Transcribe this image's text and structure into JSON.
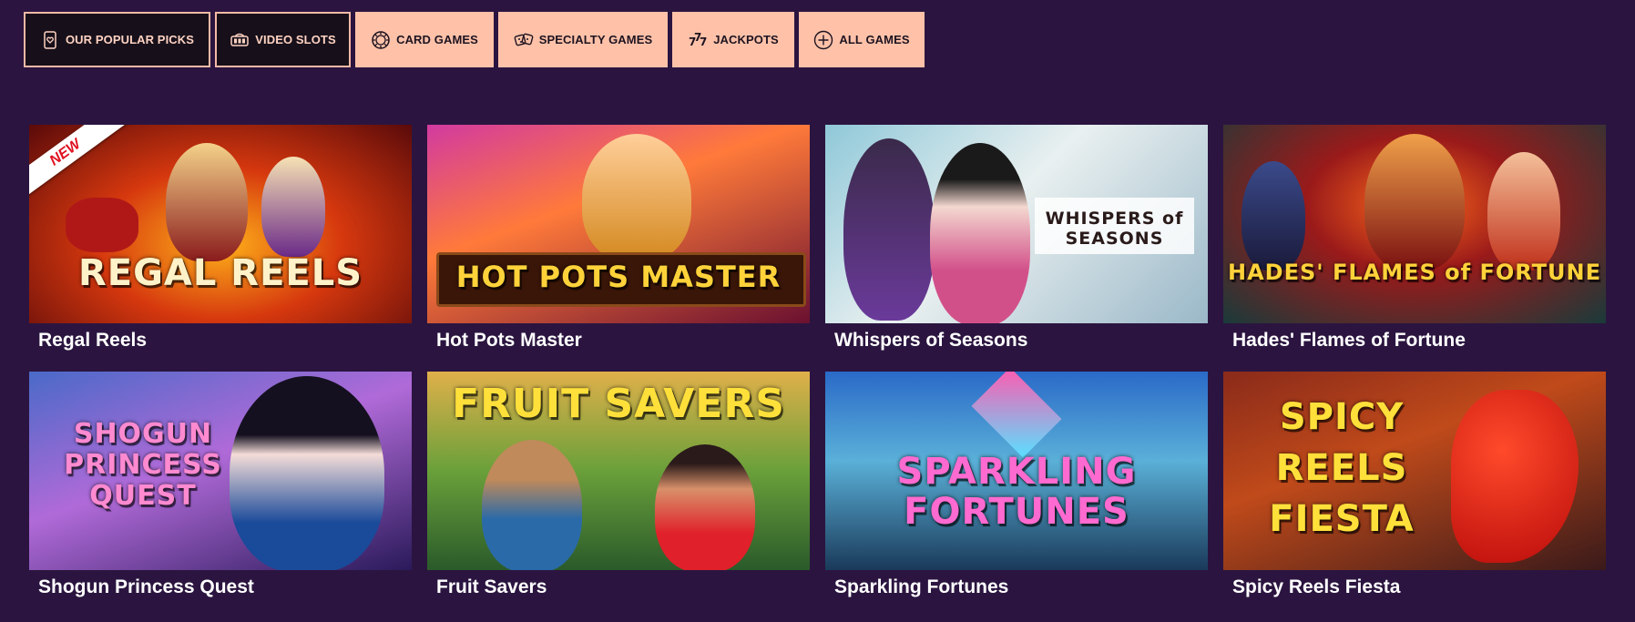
{
  "tabs": [
    {
      "label": "OUR POPULAR PICKS",
      "icon": "heart-card-icon",
      "style": "dark"
    },
    {
      "label": "VIDEO SLOTS",
      "icon": "slot-machine-icon",
      "style": "dark"
    },
    {
      "label": "CARD GAMES",
      "icon": "poker-chip-icon",
      "style": "light"
    },
    {
      "label": "SPECIALTY GAMES",
      "icon": "dice-icon",
      "style": "light"
    },
    {
      "label": "JACKPOTS",
      "icon": "sevens-icon",
      "style": "light"
    },
    {
      "label": "ALL GAMES",
      "icon": "plus-circle-icon",
      "style": "light"
    }
  ],
  "games": [
    {
      "title": "Regal Reels",
      "logo": "REGAL REELS",
      "badge": "NEW"
    },
    {
      "title": "Hot Pots Master",
      "logo": "HOT POTS MASTER"
    },
    {
      "title": "Whispers of Seasons",
      "logo": "WHISPERS of SEASONS"
    },
    {
      "title": "Hades' Flames of Fortune",
      "logo": "HADES' FLAMES of FORTUNE"
    },
    {
      "title": "Shogun Princess Quest",
      "logo": "SHOGUN PRINCESS QUEST"
    },
    {
      "title": "Fruit Savers",
      "logo": "FRUIT SAVERS"
    },
    {
      "title": "Sparkling Fortunes",
      "logo": "SPARKLING FORTUNES"
    },
    {
      "title": "Spicy Reels Fiesta",
      "logo": "SPICY REELS FIESTA"
    }
  ],
  "colors": {
    "background": "#2b1540",
    "tab_dark": "#17101a",
    "tab_light": "#ffc2a9",
    "tab_border": "#f6b9a6",
    "title_text": "#ffffff"
  }
}
